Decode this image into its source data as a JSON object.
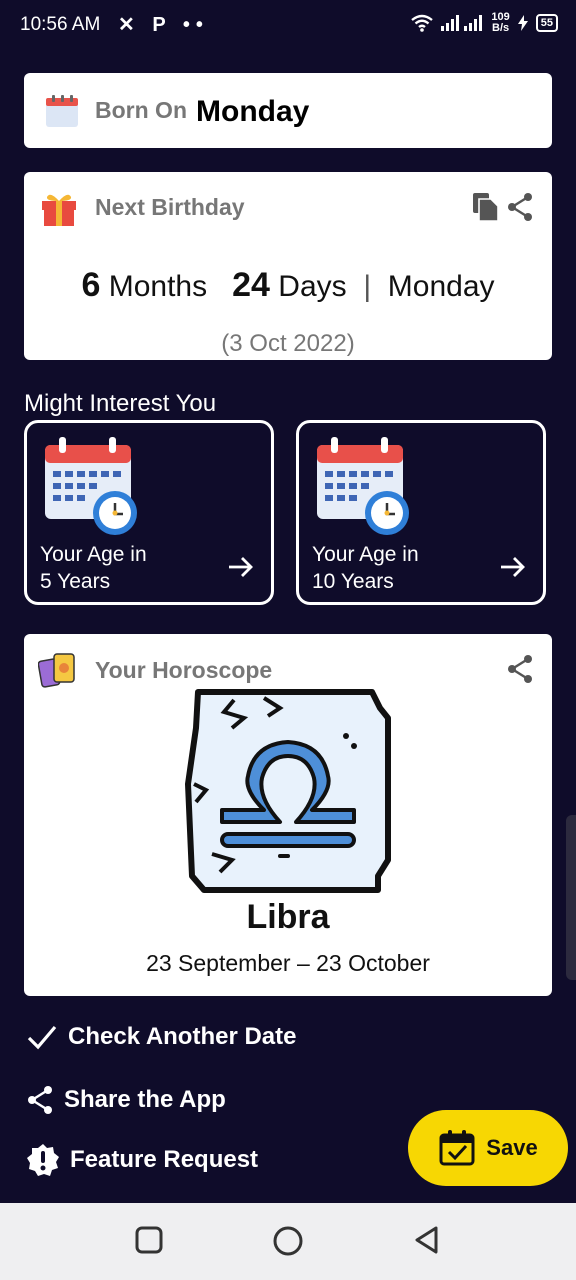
{
  "status": {
    "time": "10:56 AM",
    "left_icons": "✕ P ••",
    "speed_value": "109",
    "speed_unit": "B/s",
    "battery": "55"
  },
  "born": {
    "label": "Born On",
    "day": "Monday"
  },
  "next_birthday": {
    "title": "Next Birthday",
    "months_value": "6",
    "months_label": "Months",
    "days_value": "24",
    "days_label": "Days",
    "separator": "|",
    "weekday": "Monday",
    "date": "(3 Oct 2022)"
  },
  "might_interest": {
    "title": "Might Interest You",
    "cards": [
      {
        "line1": "Your Age in",
        "line2": "5 Years"
      },
      {
        "line1": "Your Age in",
        "line2": "10 Years"
      }
    ]
  },
  "horoscope": {
    "title": "Your Horoscope",
    "sign": "Libra",
    "range": "23 September – 23 October"
  },
  "actions": {
    "check_date": "Check Another Date",
    "share_app": "Share the App",
    "feature_request": "Feature Request"
  },
  "save": {
    "label": "Save"
  },
  "colors": {
    "background": "#0f0c2a",
    "accent": "#f7d703",
    "card": "#ffffff"
  }
}
